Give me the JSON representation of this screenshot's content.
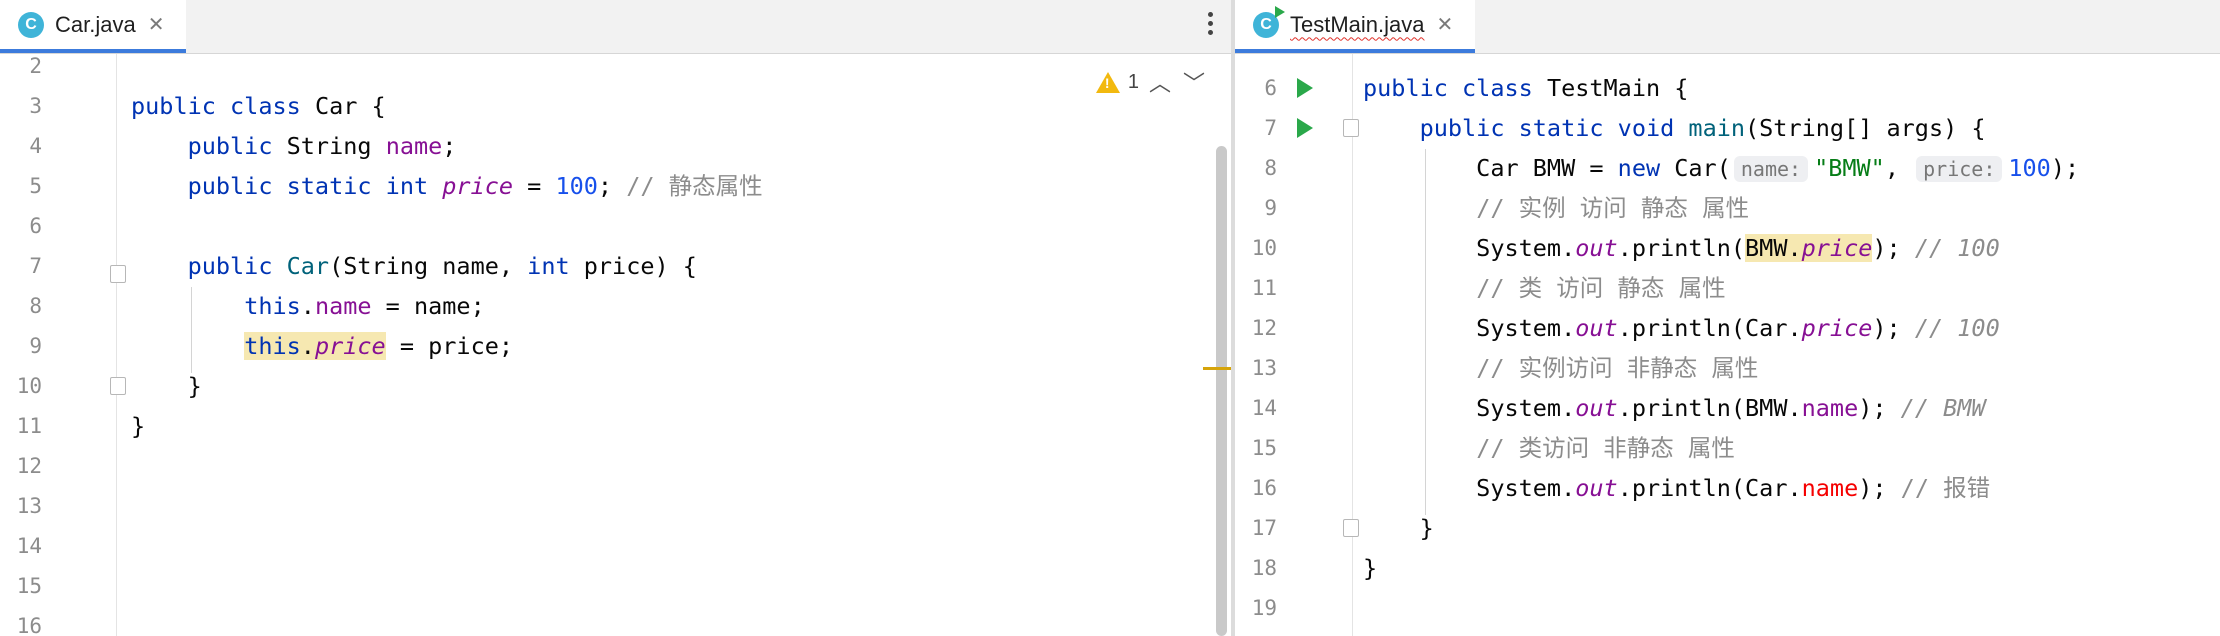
{
  "left_editor": {
    "tab": {
      "filename": "Car.java",
      "icon_letter": "C",
      "close": "✕"
    },
    "problems": {
      "warnings": "1"
    },
    "lines": [
      {
        "no": "2",
        "tokens": []
      },
      {
        "no": "3",
        "tokens": [
          {
            "t": "public class ",
            "c": "kw"
          },
          {
            "t": "Car {",
            "c": ""
          }
        ]
      },
      {
        "no": "4",
        "tokens": [
          {
            "t": "    ",
            "c": ""
          },
          {
            "t": "public ",
            "c": "kw"
          },
          {
            "t": "String ",
            "c": ""
          },
          {
            "t": "name",
            "c": "fld"
          },
          {
            "t": ";",
            "c": ""
          }
        ]
      },
      {
        "no": "5",
        "tokens": [
          {
            "t": "    ",
            "c": ""
          },
          {
            "t": "public static int ",
            "c": "kw"
          },
          {
            "t": "price",
            "c": "sfld"
          },
          {
            "t": " = ",
            "c": ""
          },
          {
            "t": "100",
            "c": "num"
          },
          {
            "t": "; ",
            "c": ""
          },
          {
            "t": "// 静态属性",
            "c": "cmt"
          }
        ]
      },
      {
        "no": "6",
        "tokens": []
      },
      {
        "no": "7",
        "tokens": [
          {
            "t": "    ",
            "c": ""
          },
          {
            "t": "public ",
            "c": "kw"
          },
          {
            "t": "Car",
            "c": "mth"
          },
          {
            "t": "(String name, ",
            "c": ""
          },
          {
            "t": "int ",
            "c": "kw"
          },
          {
            "t": "price) {",
            "c": ""
          }
        ]
      },
      {
        "no": "8",
        "tokens": [
          {
            "t": "        ",
            "c": ""
          },
          {
            "t": "this",
            "c": "kw"
          },
          {
            "t": ".",
            "c": ""
          },
          {
            "t": "name",
            "c": "fld"
          },
          {
            "t": " = name;",
            "c": ""
          }
        ]
      },
      {
        "no": "9",
        "tokens": [
          {
            "t": "        ",
            "c": ""
          },
          {
            "t": "this",
            "c": "kw hl"
          },
          {
            "t": ".",
            "c": "hl"
          },
          {
            "t": "price",
            "c": "sfld hl"
          },
          {
            "t": " = price;",
            "c": ""
          }
        ]
      },
      {
        "no": "10",
        "tokens": [
          {
            "t": "    }",
            "c": ""
          }
        ]
      },
      {
        "no": "11",
        "tokens": [
          {
            "t": "}",
            "c": ""
          }
        ]
      },
      {
        "no": "12",
        "tokens": []
      },
      {
        "no": "13",
        "tokens": []
      },
      {
        "no": "14",
        "tokens": []
      },
      {
        "no": "15",
        "tokens": []
      },
      {
        "no": "16",
        "tokens": []
      }
    ]
  },
  "right_editor": {
    "tab": {
      "filename": "TestMain.java",
      "icon_letter": "C",
      "close": "✕"
    },
    "lines": [
      {
        "no": "6",
        "tokens": [
          {
            "t": "public class ",
            "c": "kw"
          },
          {
            "t": "TestMain {",
            "c": ""
          }
        ]
      },
      {
        "no": "7",
        "tokens": [
          {
            "t": "    ",
            "c": ""
          },
          {
            "t": "public static void ",
            "c": "kw"
          },
          {
            "t": "main",
            "c": "mth"
          },
          {
            "t": "(String[] args) {",
            "c": ""
          }
        ]
      },
      {
        "no": "8",
        "tokens": [
          {
            "t": "        Car BMW = ",
            "c": ""
          },
          {
            "t": "new ",
            "c": "kw"
          },
          {
            "t": "Car(",
            "c": ""
          },
          {
            "t": "name:",
            "c": "hint"
          },
          {
            "t": "\"BMW\"",
            "c": "str"
          },
          {
            "t": ", ",
            "c": ""
          },
          {
            "t": "price:",
            "c": "hint"
          },
          {
            "t": "100",
            "c": "num"
          },
          {
            "t": ");",
            "c": ""
          }
        ]
      },
      {
        "no": "9",
        "tokens": [
          {
            "t": "        ",
            "c": ""
          },
          {
            "t": "// 实例 访问 静态 属性",
            "c": "cmt"
          }
        ]
      },
      {
        "no": "10",
        "tokens": [
          {
            "t": "        System.",
            "c": ""
          },
          {
            "t": "out",
            "c": "sfld"
          },
          {
            "t": ".println(",
            "c": ""
          },
          {
            "t": "BMW.",
            "c": "hl"
          },
          {
            "t": "price",
            "c": "sfld hl"
          },
          {
            "t": "); ",
            "c": ""
          },
          {
            "t": "// 100",
            "c": "cmti"
          }
        ]
      },
      {
        "no": "11",
        "tokens": [
          {
            "t": "        ",
            "c": ""
          },
          {
            "t": "// 类 访问 静态 属性",
            "c": "cmt"
          }
        ]
      },
      {
        "no": "12",
        "tokens": [
          {
            "t": "        System.",
            "c": ""
          },
          {
            "t": "out",
            "c": "sfld"
          },
          {
            "t": ".println(Car.",
            "c": ""
          },
          {
            "t": "price",
            "c": "sfld"
          },
          {
            "t": "); ",
            "c": ""
          },
          {
            "t": "// 100",
            "c": "cmti"
          }
        ]
      },
      {
        "no": "13",
        "tokens": [
          {
            "t": "        ",
            "c": ""
          },
          {
            "t": "// 实例访问 非静态 属性",
            "c": "cmt"
          }
        ]
      },
      {
        "no": "14",
        "tokens": [
          {
            "t": "        System.",
            "c": ""
          },
          {
            "t": "out",
            "c": "sfld"
          },
          {
            "t": ".println(BMW.",
            "c": ""
          },
          {
            "t": "name",
            "c": "fld"
          },
          {
            "t": "); ",
            "c": ""
          },
          {
            "t": "// BMW",
            "c": "cmti"
          }
        ]
      },
      {
        "no": "15",
        "tokens": [
          {
            "t": "        ",
            "c": ""
          },
          {
            "t": "// 类访问 非静态 属性",
            "c": "cmt"
          }
        ]
      },
      {
        "no": "16",
        "tokens": [
          {
            "t": "        System.",
            "c": ""
          },
          {
            "t": "out",
            "c": "sfld"
          },
          {
            "t": ".println(Car.",
            "c": ""
          },
          {
            "t": "name",
            "c": "err"
          },
          {
            "t": "); ",
            "c": ""
          },
          {
            "t": "// 报错",
            "c": "cmt"
          }
        ]
      },
      {
        "no": "17",
        "tokens": [
          {
            "t": "    }",
            "c": ""
          }
        ]
      },
      {
        "no": "18",
        "tokens": [
          {
            "t": "}",
            "c": ""
          }
        ]
      },
      {
        "no": "19",
        "tokens": []
      }
    ]
  },
  "colors": {
    "keyword": "#0033b3",
    "field": "#871094",
    "number": "#1750eb",
    "string": "#067d17",
    "comment": "#8c8c8c",
    "method": "#00627a",
    "error": "#f50000",
    "highlight": "#f6e8b1",
    "tab_accent": "#3c7bdc"
  },
  "icons": [
    "java-class-icon",
    "close-icon",
    "kebab-menu-icon",
    "warning-icon",
    "chevron-up-icon",
    "chevron-down-icon",
    "run-gutter-icon",
    "fold-marker-icon"
  ]
}
